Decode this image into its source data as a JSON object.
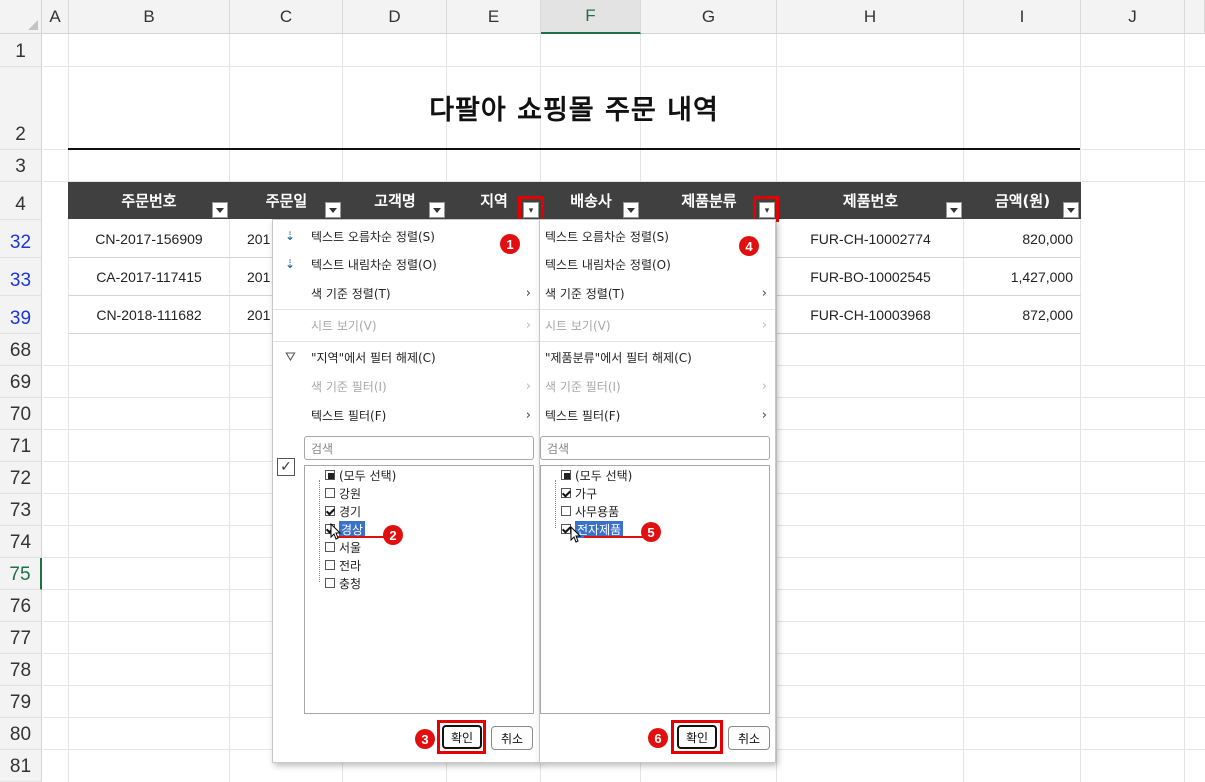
{
  "columns": [
    "A",
    "B",
    "C",
    "D",
    "E",
    "F",
    "G",
    "H",
    "I",
    "J"
  ],
  "selected_column": "F",
  "rows": [
    "1",
    "2",
    "3",
    "4",
    "32",
    "33",
    "39",
    "68",
    "69",
    "70",
    "71",
    "72",
    "73",
    "74",
    "75",
    "76",
    "77",
    "78",
    "79",
    "80",
    "81"
  ],
  "filtered_rows": [
    "32",
    "33",
    "39"
  ],
  "active_row": "75",
  "title": "다팔아 쇼핑몰 주문 내역",
  "table": {
    "headers": [
      "주문번호",
      "주문일",
      "고객명",
      "지역",
      "배송사",
      "제품분류",
      "제품번호",
      "금액(원)"
    ],
    "rows": [
      {
        "order_no": "CN-2017-156909",
        "date": "201",
        "product_no": "FUR-CH-10002774",
        "amount": "820,000"
      },
      {
        "order_no": "CA-2017-117415",
        "date": "201",
        "product_no": "FUR-BO-10002545",
        "amount": "1,427,000"
      },
      {
        "order_no": "CN-2018-111682",
        "date": "201",
        "product_no": "FUR-CH-10003968",
        "amount": "872,000"
      }
    ]
  },
  "filter_region": {
    "sort_asc": "텍스트 오름차순 정렬(S)",
    "sort_desc": "텍스트 내림차순 정렬(O)",
    "sort_by_color": "색 기준 정렬(T)",
    "sheet_view": "시트 보기(V)",
    "clear_filter": "\"지역\"에서 필터 해제(C)",
    "filter_by_color": "색 기준 필터(I)",
    "text_filter": "텍스트 필터(F)",
    "search_placeholder": "검색",
    "items": [
      {
        "label": "(모두 선택)",
        "state": "partial"
      },
      {
        "label": "강원",
        "state": "off"
      },
      {
        "label": "경기",
        "state": "on"
      },
      {
        "label": "경상",
        "state": "on"
      },
      {
        "label": "서울",
        "state": "off"
      },
      {
        "label": "전라",
        "state": "off"
      },
      {
        "label": "충청",
        "state": "off"
      }
    ],
    "ok": "확인",
    "cancel": "취소"
  },
  "filter_category": {
    "sort_asc": "텍스트 오름차순 정렬(S)",
    "sort_desc": "텍스트 내림차순 정렬(O)",
    "sort_by_color": "색 기준 정렬(T)",
    "sheet_view": "시트 보기(V)",
    "clear_filter": "\"제품분류\"에서 필터 해제(C)",
    "filter_by_color": "색 기준 필터(I)",
    "text_filter": "텍스트 필터(F)",
    "search_placeholder": "검색",
    "items": [
      {
        "label": "(모두 선택)",
        "state": "partial"
      },
      {
        "label": "가구",
        "state": "on"
      },
      {
        "label": "사무용품",
        "state": "off"
      },
      {
        "label": "전자제품",
        "state": "on"
      }
    ],
    "ok": "확인",
    "cancel": "취소"
  },
  "badges": [
    "1",
    "2",
    "3",
    "4",
    "5",
    "6"
  ],
  "colors": {
    "header_bg": "#404040",
    "accent": "#e60000",
    "selection": "#3a72c8",
    "excel_green": "#1e7145",
    "filtered_row": "#1a37d6"
  }
}
